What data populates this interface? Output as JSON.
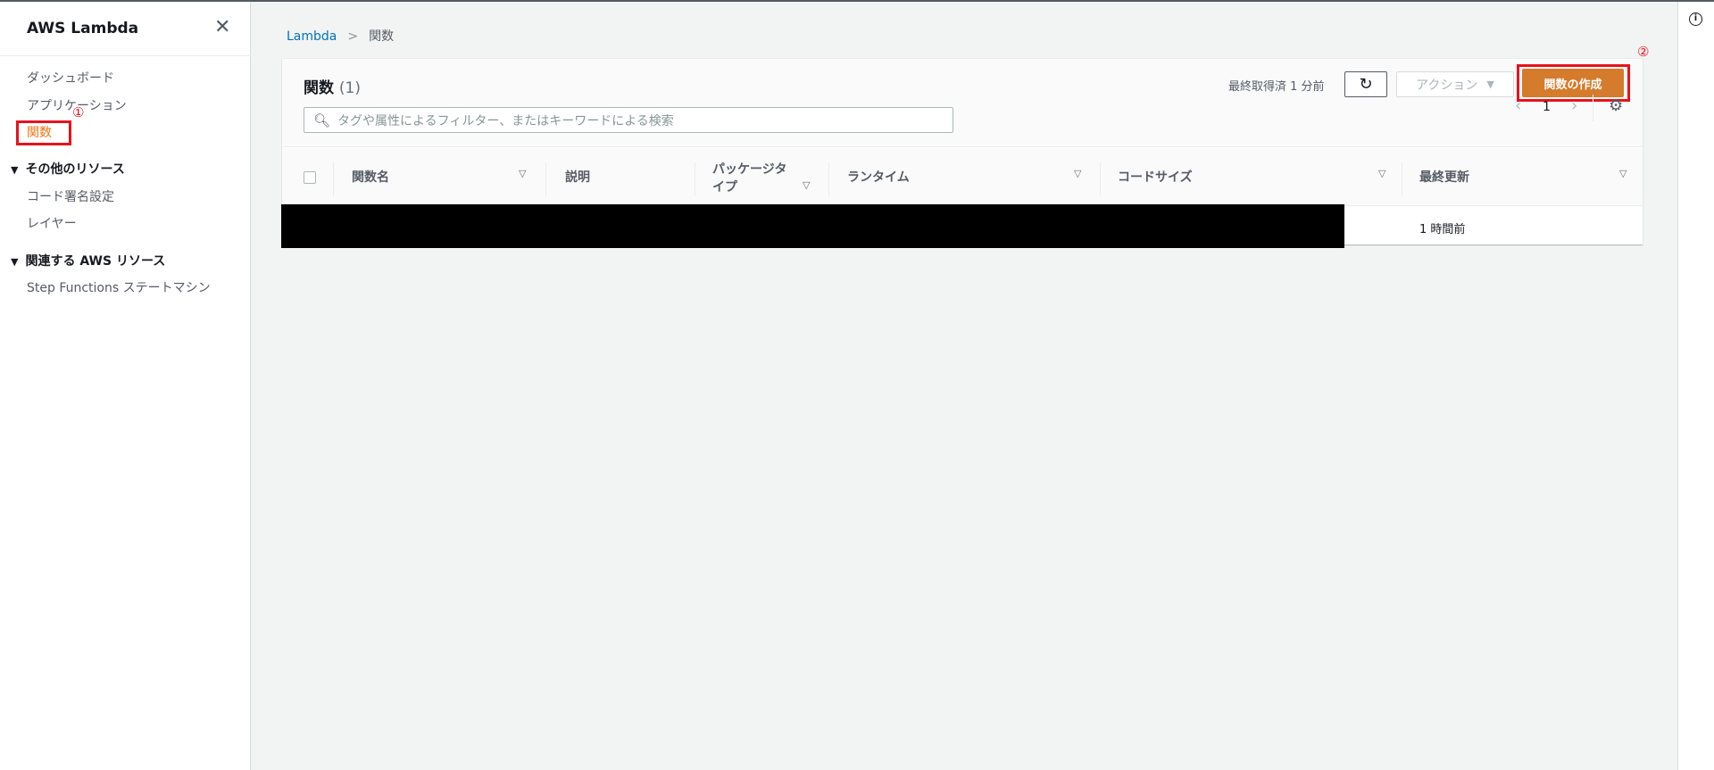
{
  "sidebar": {
    "title": "AWS Lambda",
    "items": [
      "ダッシュボード",
      "アプリケーション",
      "関数"
    ],
    "sections": [
      {
        "label": "その他のリソース",
        "items": [
          "コード署名設定",
          "レイヤー"
        ]
      },
      {
        "label": "関連する AWS リソース",
        "items": [
          "Step Functions ステートマシン"
        ]
      }
    ],
    "marker": "①"
  },
  "breadcrumb": {
    "root": "Lambda",
    "current": "関数"
  },
  "panel": {
    "title": "関数",
    "count": "(1)",
    "fetched": "最終取得済 1 分前",
    "action": "アクション",
    "create": "関数の作成",
    "marker": "②",
    "search_placeholder": "タグや属性によるフィルター、またはキーワードによる検索",
    "page": "1",
    "columns": [
      "関数名",
      "説明",
      "パッケージタイプ",
      "ランタイム",
      "コードサイズ",
      "最終更新"
    ],
    "rows": [
      {
        "last_modified": "1 時間前"
      }
    ]
  },
  "colors": {
    "accent": "#ec7211",
    "primary_button": "#d47b2c",
    "annotation": "#e8121c"
  }
}
